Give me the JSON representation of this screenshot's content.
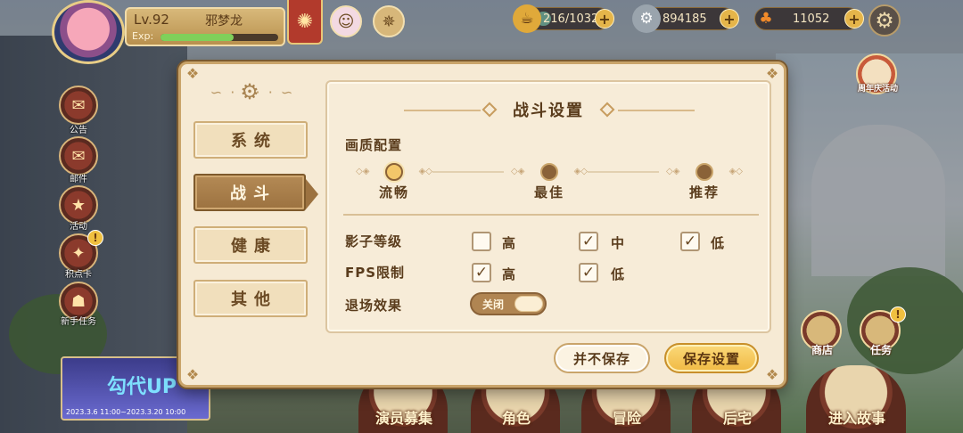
{
  "player": {
    "level": "Lv.92",
    "name": "邪梦龙",
    "exp_label": "Exp:",
    "exp_fraction": 0.62
  },
  "resources": [
    {
      "icon": "stamina-icon",
      "value": "216/1032",
      "fill_fraction": 0.21
    },
    {
      "icon": "coin-icon",
      "value": "894185"
    },
    {
      "icon": "carrot-icon",
      "value": "11052"
    }
  ],
  "side_menu": [
    "公告",
    "邮件",
    "活动",
    "积点卡",
    "新手任务"
  ],
  "event_banner": {
    "title": "勾代UP",
    "dates": "2023.3.6 11:00~2023.3.20 10:00"
  },
  "bottom_nav": [
    "演员募集",
    "角色",
    "冒险",
    "后宅",
    "进入故事"
  ],
  "right_side": {
    "shop": "商店",
    "task": "任务",
    "event": "周年庆活动"
  },
  "dialog": {
    "tabs": [
      {
        "label": "系统",
        "active": false
      },
      {
        "label": "战斗",
        "active": true
      },
      {
        "label": "健康",
        "active": false
      },
      {
        "label": "其他",
        "active": false
      }
    ],
    "title": "战斗设置",
    "quality": {
      "label": "画质配置",
      "options": [
        "流畅",
        "最佳",
        "推荐"
      ],
      "selected": "流畅"
    },
    "shadow": {
      "label": "影子等级",
      "options": [
        {
          "label": "高",
          "checked": false
        },
        {
          "label": "中",
          "checked": true
        },
        {
          "label": "低",
          "checked": true
        }
      ]
    },
    "fps": {
      "label": "FPS限制",
      "options": [
        {
          "label": "高",
          "checked": true
        },
        {
          "label": "低",
          "checked": true
        }
      ]
    },
    "exit_effect": {
      "label": "退场效果",
      "toggle_text": "关闭",
      "on": false
    },
    "buttons": {
      "no_save": "并不保存",
      "save": "保存设置"
    }
  },
  "colors": {
    "panel_bg": "#f7ecd8",
    "accent_brown": "#9c7240",
    "save_gold": "#f0b943"
  }
}
